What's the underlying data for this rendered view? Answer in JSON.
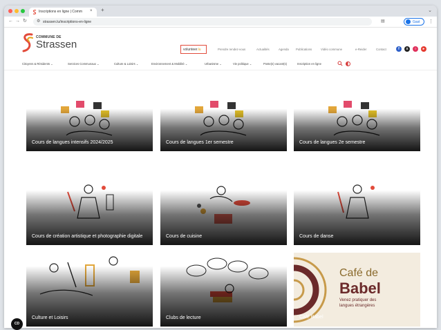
{
  "browser": {
    "tab_title": "Inscriptions en ligne | Comm",
    "tab_close": "×",
    "new_tab": "+",
    "url": "strassen.lu/inscriptions-en-ligne",
    "profile_label": "Gast"
  },
  "site": {
    "logo_small": "COMMUNE DE",
    "logo_big": "Strassen",
    "volunteer_main": "volunteer",
    "volunteer_suffix": ".lu",
    "top_links": [
      "Prendre rendez-vous",
      "Actualités",
      "Agenda",
      "Publications",
      "Vidéo commune",
      "e-Reider",
      "Contact"
    ]
  },
  "nav": {
    "items": [
      "Citoyens & Résidents ⌄",
      "Services Communaux ⌄",
      "Culture & Loisirs ⌄",
      "Environnement & Mobilité ⌄",
      "Urbanisme ⌄",
      "Vie politique ⌄",
      "Poste(s) vacant(s)",
      "Inscription en ligne"
    ]
  },
  "cards": [
    "Cours de langues intensifs 2024/2025",
    "Cours de langues 1er semestre",
    "Cours de langues 2e semestre",
    "Cours de création artistique et photographie digitale",
    "Cours de cuisine",
    "Cours de danse",
    "Culture et Loisirs",
    "Clubs de lecture",
    "Café Babel"
  ],
  "cafe": {
    "title_line1": "Café de",
    "title_line2": "Babel",
    "sub_line1": "Venez pratiquer des",
    "sub_line2": "langues étrangères"
  },
  "badge": "CD",
  "colors": {
    "brand_red": "#e24b3b",
    "brand_orange": "#e6a117",
    "cafe_brown": "#6b2a2a",
    "cafe_gold": "#8a6a2c"
  }
}
